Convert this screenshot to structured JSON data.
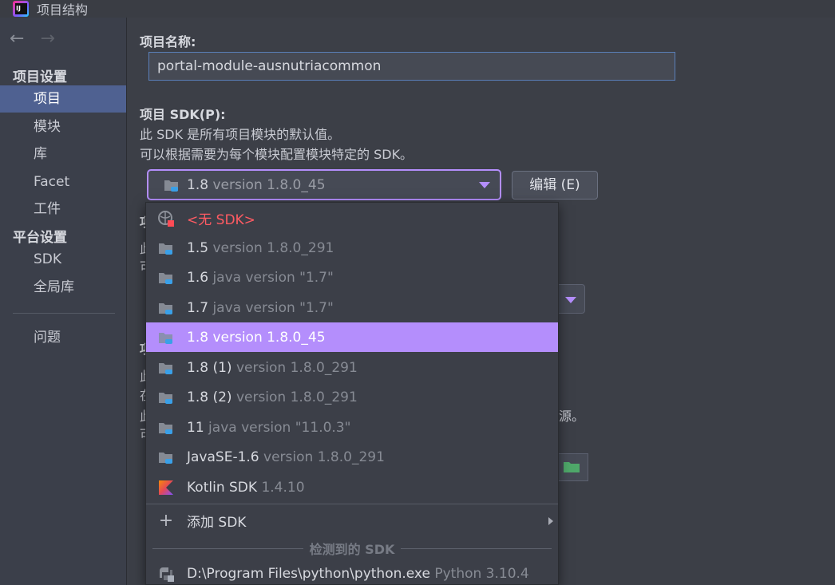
{
  "window": {
    "title": "项目结构"
  },
  "sidebar": {
    "project_settings_header": "项目设置",
    "platform_settings_header": "平台设置",
    "items": [
      {
        "label": "项目",
        "selected": true
      },
      {
        "label": "模块"
      },
      {
        "label": "库"
      },
      {
        "label": "Facet"
      },
      {
        "label": "工件"
      }
    ],
    "platform_items": [
      {
        "label": "SDK"
      },
      {
        "label": "全局库"
      }
    ],
    "problems_label": "问题"
  },
  "main": {
    "name_label": "项目名称:",
    "name_value": "portal-module-ausnutriacommon",
    "sdk_label": "项目 SDK(P):",
    "sdk_desc_1": "此 SDK 是所有项目模块的默认值。",
    "sdk_desc_2": "可以根据需要为每个模块配置模块特定的 SDK。",
    "sdk_selected_name": "1.8",
    "sdk_selected_version": "version 1.8.0_45",
    "edit_button": "编辑 (E)",
    "partial_texts": [
      "项",
      "此",
      "可",
      "项",
      "此",
      "在",
      "此",
      "可"
    ],
    "partial_right_text": "源。"
  },
  "sdk_popup": {
    "items": [
      {
        "name": "<无 SDK>",
        "version": "",
        "icon": "globe-nosdk-icon",
        "nosdk": true
      },
      {
        "name": "1.5",
        "version": "version 1.8.0_291",
        "icon": "jdk-folder-icon"
      },
      {
        "name": "1.6",
        "version": "java version \"1.7\"",
        "icon": "jdk-folder-icon"
      },
      {
        "name": "1.7",
        "version": "java version \"1.7\"",
        "icon": "jdk-folder-icon"
      },
      {
        "name": "1.8",
        "version": "version 1.8.0_45",
        "icon": "jdk-folder-icon",
        "selected": true
      },
      {
        "name": "1.8 (1)",
        "version": "version 1.8.0_291",
        "icon": "jdk-folder-icon"
      },
      {
        "name": "1.8 (2)",
        "version": "version 1.8.0_291",
        "icon": "jdk-folder-icon"
      },
      {
        "name": "11",
        "version": "java version \"11.0.3\"",
        "icon": "jdk-folder-icon"
      },
      {
        "name": "JavaSE-1.6",
        "version": "version 1.8.0_291",
        "icon": "jdk-folder-icon"
      },
      {
        "name": "Kotlin SDK",
        "version": "1.4.10",
        "icon": "kotlin-icon"
      }
    ],
    "add_sdk_label": "添加 SDK",
    "detected_group_label": "检测到的 SDK",
    "detected_items": [
      {
        "name": "D:\\Program Files\\python\\python.exe",
        "version": "Python 3.10.4",
        "icon": "python-icon"
      }
    ]
  },
  "colors": {
    "accent": "#b48efc",
    "sidebar_selected": "#4f6191",
    "nosdk_red": "#ff5b63"
  }
}
